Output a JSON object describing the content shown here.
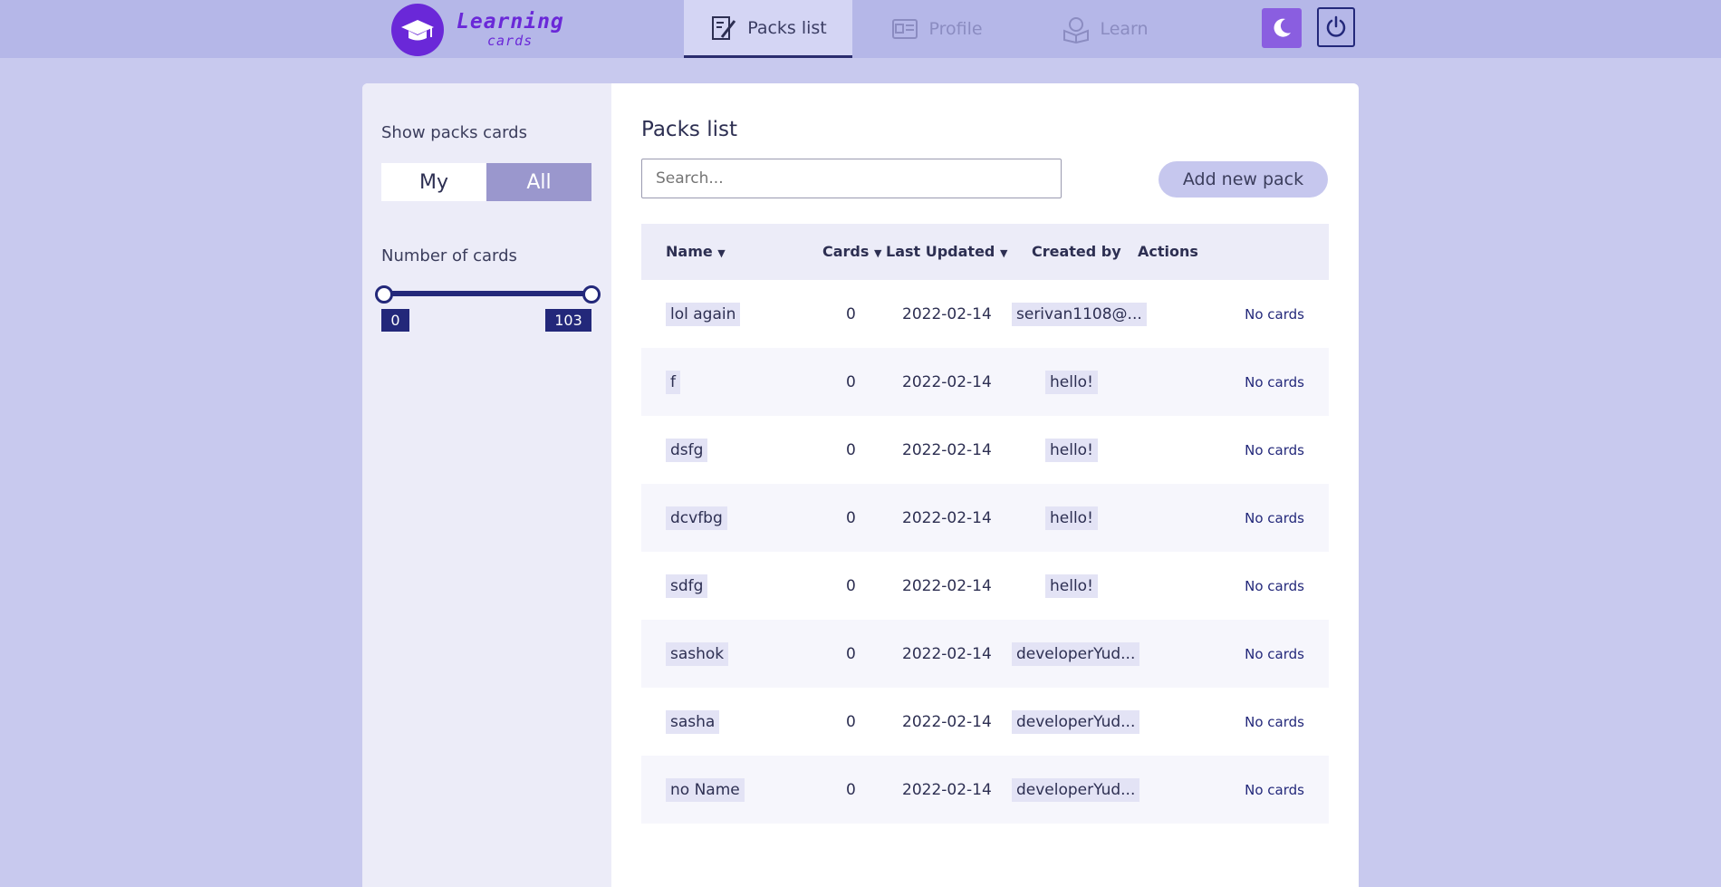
{
  "header": {
    "logo": {
      "line1": "Learning",
      "line2": "cards",
      "icon": "graduation-cap-icon"
    },
    "nav": [
      {
        "label": "Packs list",
        "icon": "pencil-pad-icon",
        "active": true
      },
      {
        "label": "Profile",
        "icon": "id-card-icon",
        "active": false
      },
      {
        "label": "Learn",
        "icon": "reading-brain-icon",
        "active": false
      }
    ],
    "theme_icon": "moon-icon",
    "logout_icon": "power-icon"
  },
  "sidebar": {
    "show_title": "Show packs cards",
    "toggle": {
      "my": "My",
      "all": "All",
      "selected": "All"
    },
    "number_title": "Number of cards",
    "range": {
      "min": "0",
      "max": "103"
    }
  },
  "main": {
    "title": "Packs list",
    "search": {
      "placeholder": "Search...",
      "value": ""
    },
    "add_button": "Add new pack",
    "columns": {
      "name": "Name",
      "cards": "Cards",
      "updated": "Last Updated",
      "created": "Created by",
      "actions": "Actions"
    },
    "rows": [
      {
        "name": "lol again",
        "cards": "0",
        "updated": "2022-02-14",
        "created": "serivan1108@...",
        "action": "No cards"
      },
      {
        "name": "f",
        "cards": "0",
        "updated": "2022-02-14",
        "created": "hello!",
        "action": "No cards"
      },
      {
        "name": "dsfg",
        "cards": "0",
        "updated": "2022-02-14",
        "created": "hello!",
        "action": "No cards"
      },
      {
        "name": "dcvfbg",
        "cards": "0",
        "updated": "2022-02-14",
        "created": "hello!",
        "action": "No cards"
      },
      {
        "name": "sdfg",
        "cards": "0",
        "updated": "2022-02-14",
        "created": "hello!",
        "action": "No cards"
      },
      {
        "name": "sashok",
        "cards": "0",
        "updated": "2022-02-14",
        "created": "developerYud...",
        "action": "No cards"
      },
      {
        "name": "sasha",
        "cards": "0",
        "updated": "2022-02-14",
        "created": "developerYud...",
        "action": "No cards"
      },
      {
        "name": "no Name",
        "cards": "0",
        "updated": "2022-02-14",
        "created": "developerYud...",
        "action": "No cards"
      }
    ]
  }
}
